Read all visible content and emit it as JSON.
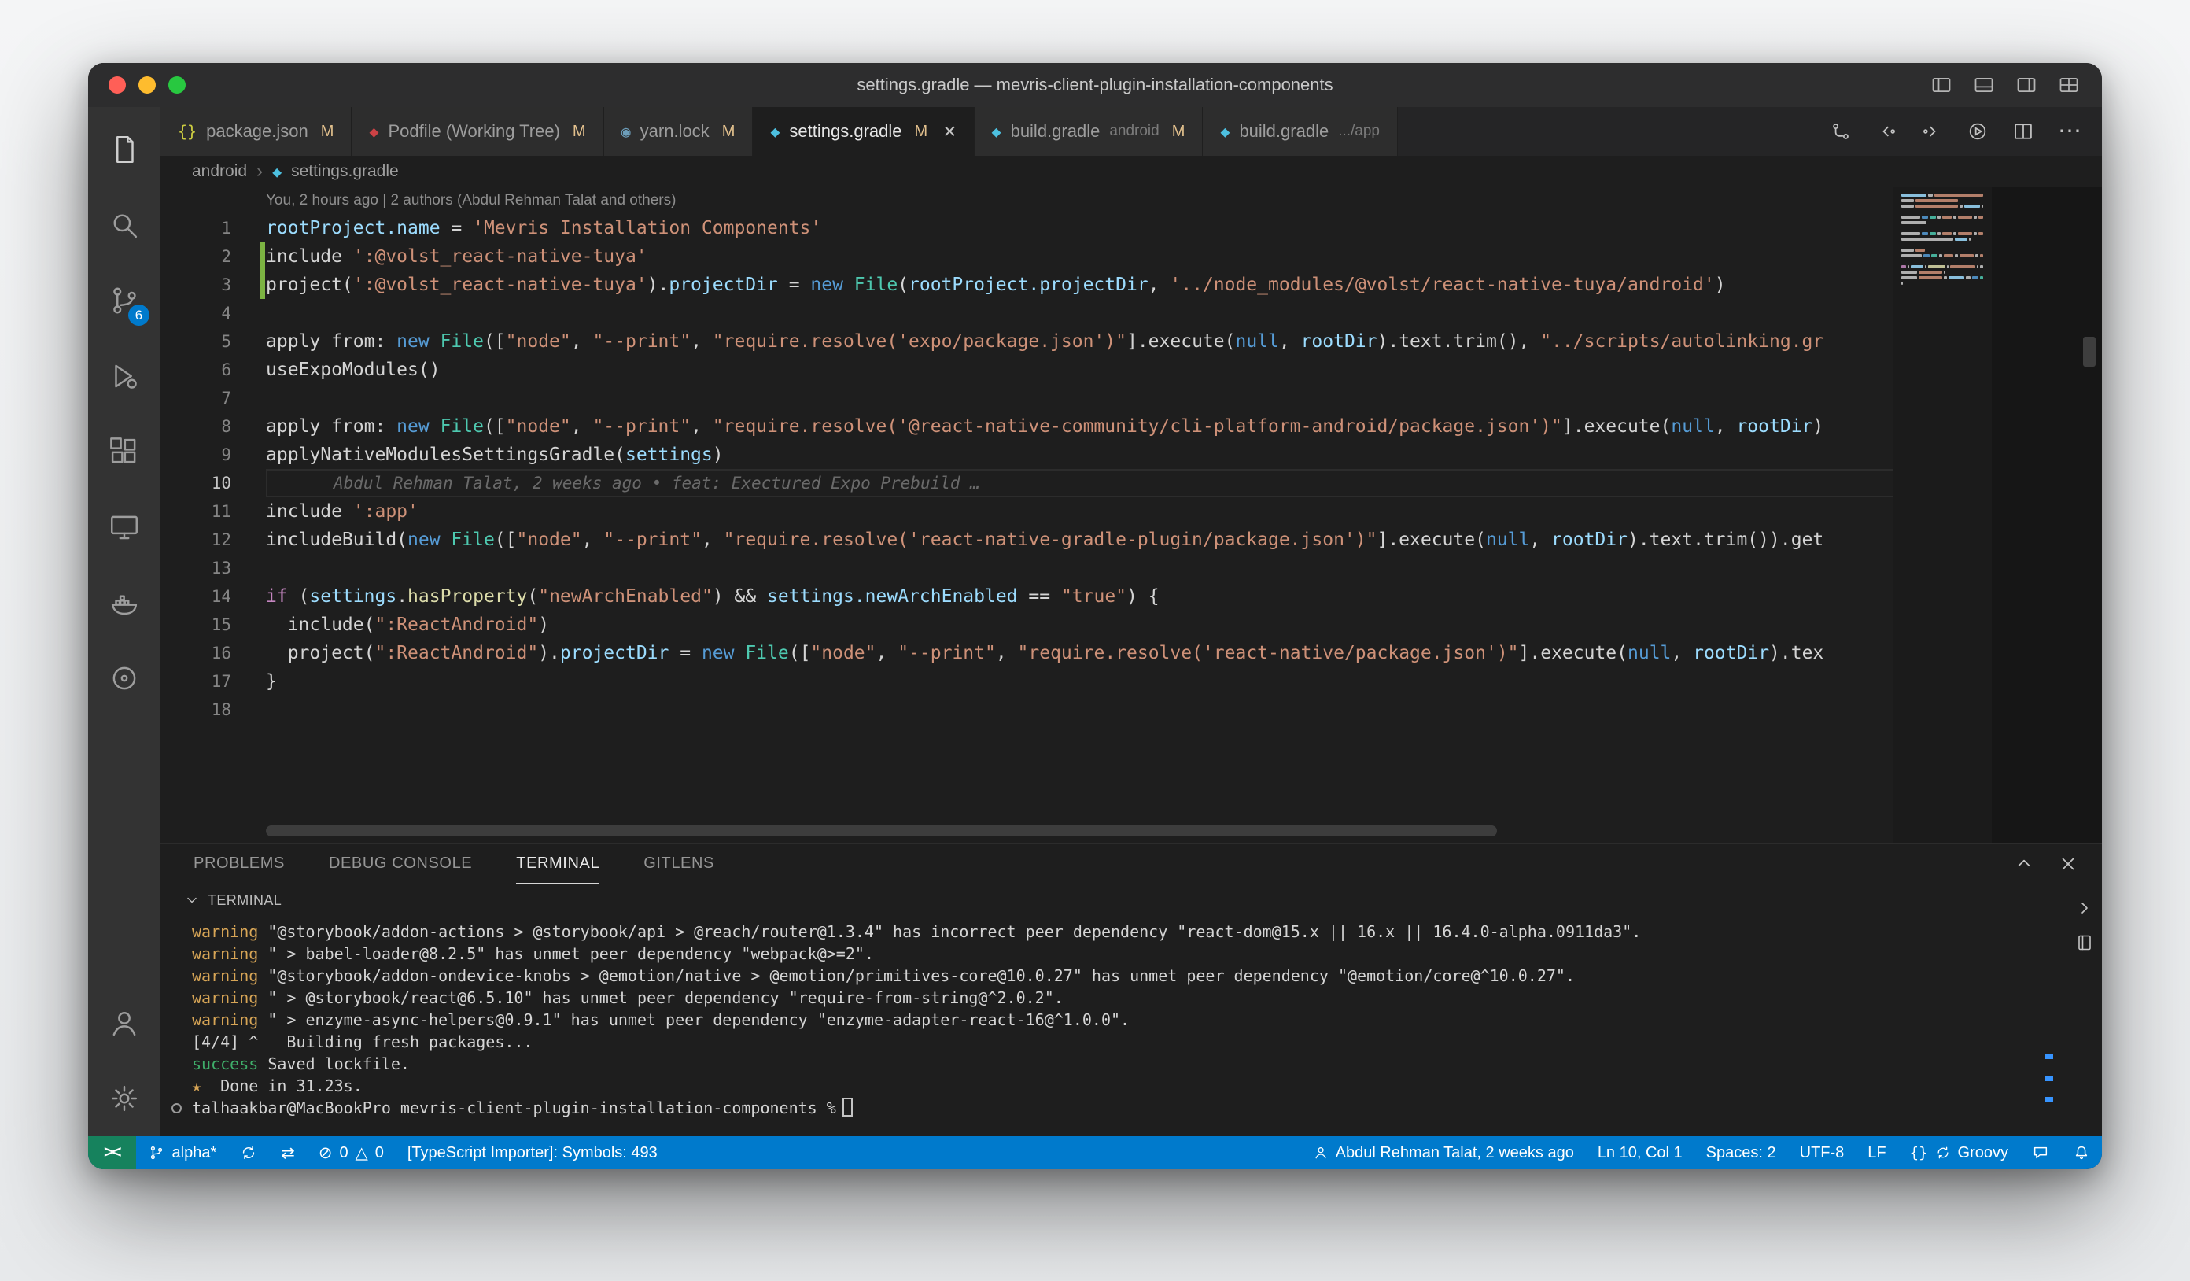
{
  "window": {
    "title": "settings.gradle — mevris-client-plugin-installation-components"
  },
  "activity_bar": {
    "scm_badge": "6"
  },
  "icons": {
    "more": "⋯",
    "close_glyph": "×"
  },
  "tabs": [
    {
      "icon": "json-icon",
      "glyph": "{}",
      "color": "#cbcb41",
      "label": "package.json",
      "desc": "",
      "badge": "M",
      "active": false,
      "close": false
    },
    {
      "icon": "ruby-icon",
      "glyph": "◆",
      "color": "#cc4245",
      "label": "Podfile (Working Tree)",
      "desc": "",
      "badge": "M",
      "active": false,
      "close": false
    },
    {
      "icon": "yarn-icon",
      "glyph": "◉",
      "color": "#6d9eba",
      "label": "yarn.lock",
      "desc": "",
      "badge": "M",
      "active": false,
      "close": false
    },
    {
      "icon": "gradle-icon",
      "glyph": "◆",
      "color": "#4dc0e0",
      "label": "settings.gradle",
      "desc": "",
      "badge": "M",
      "active": true,
      "close": true
    },
    {
      "icon": "gradle-icon",
      "glyph": "◆",
      "color": "#4dc0e0",
      "label": "build.gradle",
      "desc": "android",
      "badge": "M",
      "active": false,
      "close": false
    },
    {
      "icon": "gradle-icon",
      "glyph": "◆",
      "color": "#4dc0e0",
      "label": "build.gradle",
      "desc": ".../app",
      "badge": "",
      "active": false,
      "close": false
    }
  ],
  "breadcrumbs": {
    "items": [
      "android",
      "settings.gradle"
    ],
    "sep": "›",
    "icon_glyph": "◆"
  },
  "editor": {
    "codelens": "You, 2 hours ago | 2 authors (Abdul Rehman Talat and others)",
    "lines": [
      {
        "n": "1",
        "tokens": [
          [
            "rootProject.name",
            "var"
          ],
          [
            " = ",
            "fg"
          ],
          [
            "'Mevris Installation Components'",
            "str"
          ]
        ]
      },
      {
        "n": "2",
        "tokens": [
          [
            "include ",
            "fg"
          ],
          [
            "':@volst_react-native-tuya'",
            "str"
          ]
        ]
      },
      {
        "n": "3",
        "tokens": [
          [
            "project(",
            "fg"
          ],
          [
            "':@volst_react-native-tuya'",
            "str"
          ],
          [
            ").",
            "fg"
          ],
          [
            "projectDir",
            "var"
          ],
          [
            " = ",
            "fg"
          ],
          [
            "new ",
            "kw"
          ],
          [
            "File",
            "cls"
          ],
          [
            "(",
            "fg"
          ],
          [
            "rootProject.projectDir",
            "var"
          ],
          [
            ", ",
            "fg"
          ],
          [
            "'../node_modules/@volst/react-native-tuya/android'",
            "str"
          ],
          [
            ")",
            "fg"
          ]
        ]
      },
      {
        "n": "4",
        "tokens": []
      },
      {
        "n": "5",
        "tokens": [
          [
            "apply from: ",
            "fg"
          ],
          [
            "new ",
            "kw"
          ],
          [
            "File",
            "cls"
          ],
          [
            "([",
            "fg"
          ],
          [
            "\"node\"",
            "str"
          ],
          [
            ", ",
            "fg"
          ],
          [
            "\"--print\"",
            "str"
          ],
          [
            ", ",
            "fg"
          ],
          [
            "\"require.resolve('expo/package.json')\"",
            "str"
          ],
          [
            "].execute(",
            "fg"
          ],
          [
            "null",
            "kw"
          ],
          [
            ", ",
            "fg"
          ],
          [
            "rootDir",
            "var"
          ],
          [
            ").text.trim(), ",
            "fg"
          ],
          [
            "\"../scripts/autolinking.gr",
            "str"
          ]
        ]
      },
      {
        "n": "6",
        "tokens": [
          [
            "useExpoModules()",
            "fg"
          ]
        ]
      },
      {
        "n": "7",
        "tokens": []
      },
      {
        "n": "8",
        "tokens": [
          [
            "apply from: ",
            "fg"
          ],
          [
            "new ",
            "kw"
          ],
          [
            "File",
            "cls"
          ],
          [
            "([",
            "fg"
          ],
          [
            "\"node\"",
            "str"
          ],
          [
            ", ",
            "fg"
          ],
          [
            "\"--print\"",
            "str"
          ],
          [
            ", ",
            "fg"
          ],
          [
            "\"require.resolve('@react-native-community/cli-platform-android/package.json')\"",
            "str"
          ],
          [
            "].execute(",
            "fg"
          ],
          [
            "null",
            "kw"
          ],
          [
            ", ",
            "fg"
          ],
          [
            "rootDir",
            "var"
          ],
          [
            ")",
            "fg"
          ]
        ]
      },
      {
        "n": "9",
        "tokens": [
          [
            "applyNativeModulesSettingsGradle(",
            "fg"
          ],
          [
            "settings",
            "var"
          ],
          [
            ")",
            "fg"
          ]
        ]
      },
      {
        "n": "10",
        "current": true,
        "tokens": [],
        "blame": "Abdul Rehman Talat, 2 weeks ago • feat: Exectured Expo Prebuild …"
      },
      {
        "n": "11",
        "tokens": [
          [
            "include ",
            "fg"
          ],
          [
            "':app'",
            "str"
          ]
        ]
      },
      {
        "n": "12",
        "tokens": [
          [
            "includeBuild(",
            "fg"
          ],
          [
            "new ",
            "kw"
          ],
          [
            "File",
            "cls"
          ],
          [
            "([",
            "fg"
          ],
          [
            "\"node\"",
            "str"
          ],
          [
            ", ",
            "fg"
          ],
          [
            "\"--print\"",
            "str"
          ],
          [
            ", ",
            "fg"
          ],
          [
            "\"require.resolve('react-native-gradle-plugin/package.json')\"",
            "str"
          ],
          [
            "].execute(",
            "fg"
          ],
          [
            "null",
            "kw"
          ],
          [
            ", ",
            "fg"
          ],
          [
            "rootDir",
            "var"
          ],
          [
            ").text.trim()).get",
            "fg"
          ]
        ]
      },
      {
        "n": "13",
        "tokens": []
      },
      {
        "n": "14",
        "tokens": [
          [
            "if ",
            "ctrl"
          ],
          [
            "(",
            "fg"
          ],
          [
            "settings",
            "var"
          ],
          [
            ".",
            "fg"
          ],
          [
            "hasProperty",
            "fn"
          ],
          [
            "(",
            "fg"
          ],
          [
            "\"newArchEnabled\"",
            "str"
          ],
          [
            ")",
            "fg"
          ],
          [
            " && ",
            "fg"
          ],
          [
            "settings.newArchEnabled",
            "var"
          ],
          [
            " == ",
            "fg"
          ],
          [
            "\"true\"",
            "str"
          ],
          [
            ") {",
            "fg"
          ]
        ]
      },
      {
        "n": "15",
        "tokens": [
          [
            "  include(",
            "fg"
          ],
          [
            "\":ReactAndroid\"",
            "str"
          ],
          [
            ")",
            "fg"
          ]
        ]
      },
      {
        "n": "16",
        "tokens": [
          [
            "  project(",
            "fg"
          ],
          [
            "\":ReactAndroid\"",
            "str"
          ],
          [
            ").",
            "fg"
          ],
          [
            "projectDir",
            "var"
          ],
          [
            " = ",
            "fg"
          ],
          [
            "new ",
            "kw"
          ],
          [
            "File",
            "cls"
          ],
          [
            "([",
            "fg"
          ],
          [
            "\"node\"",
            "str"
          ],
          [
            ", ",
            "fg"
          ],
          [
            "\"--print\"",
            "str"
          ],
          [
            ", ",
            "fg"
          ],
          [
            "\"require.resolve('react-native/package.json')\"",
            "str"
          ],
          [
            "].execute(",
            "fg"
          ],
          [
            "null",
            "kw"
          ],
          [
            ", ",
            "fg"
          ],
          [
            "rootDir",
            "var"
          ],
          [
            ").tex",
            "fg"
          ]
        ]
      },
      {
        "n": "17",
        "tokens": [
          [
            "}",
            "fg"
          ]
        ]
      },
      {
        "n": "18",
        "tokens": []
      }
    ]
  },
  "panel": {
    "tabs": [
      {
        "label": "PROBLEMS"
      },
      {
        "label": "DEBUG CONSOLE"
      },
      {
        "label": "TERMINAL"
      },
      {
        "label": "GITLENS"
      }
    ],
    "active_tab": "TERMINAL",
    "terminal": {
      "header": "TERMINAL",
      "lines": [
        {
          "tokens": [
            [
              "warning",
              "warn"
            ],
            [
              " \"@storybook/addon-actions > @storybook/api > @reach/router@1.3.4\" has incorrect peer dependency \"react-dom@15.x || 16.x || 16.4.0-alpha.0911da3\".",
              "fg"
            ]
          ]
        },
        {
          "tokens": [
            [
              "warning",
              "warn"
            ],
            [
              " \" > babel-loader@8.2.5\" has unmet peer dependency \"webpack@>=2\".",
              "fg"
            ]
          ]
        },
        {
          "tokens": [
            [
              "warning",
              "warn"
            ],
            [
              " \"@storybook/addon-ondevice-knobs > @emotion/native > @emotion/primitives-core@10.0.27\" has unmet peer dependency \"@emotion/core@^10.0.27\".",
              "fg"
            ]
          ]
        },
        {
          "tokens": [
            [
              "warning",
              "warn"
            ],
            [
              " \" > @storybook/react@6.5.10\" has unmet peer dependency \"require-from-string@^2.0.2\".",
              "fg"
            ]
          ]
        },
        {
          "tokens": [
            [
              "warning",
              "warn"
            ],
            [
              " \" > enzyme-async-helpers@0.9.1\" has unmet peer dependency \"enzyme-adapter-react-16@^1.0.0\".",
              "fg"
            ]
          ]
        },
        {
          "tokens": [
            [
              "[4/4] ^   Building fresh packages...",
              "fg"
            ]
          ]
        },
        {
          "tokens": [
            [
              "success",
              "ok"
            ],
            [
              " Saved lockfile.",
              "fg"
            ]
          ]
        },
        {
          "tokens": [
            [
              "★",
              "warn"
            ],
            [
              "  Done in 31.23s.",
              "fg"
            ]
          ]
        },
        {
          "marker": true,
          "cursor": true,
          "tokens": [
            [
              "talhaakbar@MacBookPro ",
              "fg"
            ],
            [
              "mevris-client-plugin-installation-components",
              "fg"
            ],
            [
              " %",
              "fg"
            ]
          ]
        }
      ]
    }
  },
  "status_bar": {
    "remote_glyph": "><",
    "branch": "alpha*",
    "compare_glyph": "⇄",
    "errors_glyph": "⊘",
    "errors": "0",
    "warnings_glyph": "△",
    "warnings": "0",
    "ts_importer": "[TypeScript Importer]: Symbols: 493",
    "blame": "Abdul Rehman Talat, 2 weeks ago",
    "cursor_pos": "Ln 10, Col 1",
    "indent": "Spaces: 2",
    "encoding": "UTF-8",
    "eol": "LF",
    "braces_glyph": "{}",
    "language": "Groovy"
  }
}
